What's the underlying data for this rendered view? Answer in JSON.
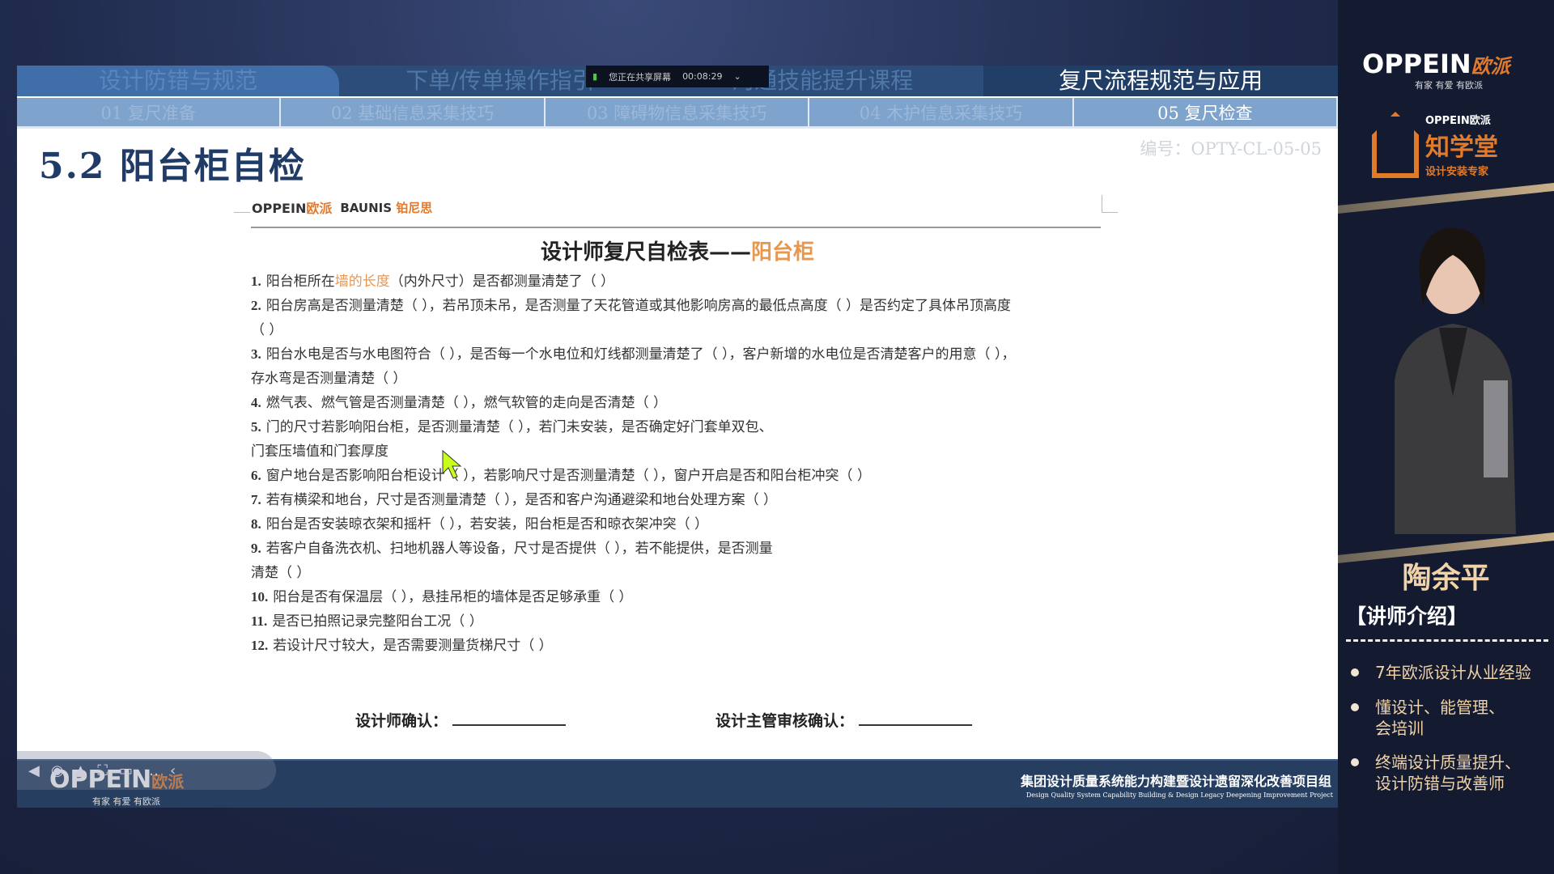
{
  "header": {
    "modules": [
      "设计防错与规范",
      "下单/传单操作指引",
      "沟通技能提升课程",
      "复尺流程规范与应用"
    ],
    "active_module": 3,
    "tabs": [
      "01  复尺准备",
      "02  基础信息采集技巧",
      "03  障碍物信息采集技巧",
      "04  木护信息采集技巧",
      "05  复尺检查"
    ],
    "active_tab": 4
  },
  "share_bar": {
    "text": "您正在共享屏幕",
    "time": "00:08:29"
  },
  "slide": {
    "title": "5.2  阳台柜自检",
    "code": "编号：OPTY-CL-05-05"
  },
  "doc": {
    "logo_oppein": "OPPEIN",
    "logo_oppein_cn": "欧派",
    "logo_baunis": "BAUNIS",
    "logo_baunis_cn": "铂尼思",
    "title": "设计师复尺自检表——",
    "title_highlight": "阳台柜",
    "lines": [
      {
        "num": "1.",
        "segs": [
          {
            "t": "阳台柜所在"
          },
          {
            "t": "墙的长度",
            "hl": true
          },
          {
            "t": "（内外尺寸）是否都测量清楚了（    ）"
          }
        ]
      },
      {
        "num": "2.",
        "segs": [
          {
            "t": "阳台房高是否测量清楚（    ），若吊顶未吊，是否测量了天花管道或其他影响房高的最低点高度（    ）是否约定了具体吊顶高度"
          }
        ]
      },
      {
        "num": "",
        "segs": [
          {
            "t": "（    ）"
          }
        ]
      },
      {
        "num": "3.",
        "segs": [
          {
            "t": "阳台水电是否与水电图符合（    ），是否每一个水电位和灯线都测量清楚了（    ），客户新增的水电位是否清楚客户的用意（    ），"
          }
        ]
      },
      {
        "num": "",
        "segs": [
          {
            "t": "存水弯是否测量清楚（    ）"
          }
        ]
      },
      {
        "num": "4.",
        "segs": [
          {
            "t": "燃气表、燃气管是否测量清楚（    ），燃气软管的走向是否清楚（    ）"
          }
        ]
      },
      {
        "num": "5.",
        "segs": [
          {
            "t": "门的尺寸若影响阳台柜，是否测量清楚（    ），若门未安装，是否确定好门套单双包、"
          }
        ]
      },
      {
        "num": "",
        "segs": [
          {
            "t": "门套压墙值和门套厚度"
          }
        ]
      },
      {
        "num": "6.",
        "segs": [
          {
            "t": "窗户地台是否影响阳台柜设计（    ），若影响尺寸是否测量清楚（    ），窗户开启是否和阳台柜冲突（    ）"
          }
        ]
      },
      {
        "num": "7.",
        "segs": [
          {
            "t": "若有横梁和地台，尺寸是否测量清楚（    ），是否和客户沟通避梁和地台处理方案（    ）"
          }
        ]
      },
      {
        "num": "8.",
        "segs": [
          {
            "t": "阳台是否安装晾衣架和摇杆（    ），若安装，阳台柜是否和晾衣架冲突（    ）"
          }
        ]
      },
      {
        "num": "9.",
        "segs": [
          {
            "t": "若客户自备洗衣机、扫地机器人等设备，尺寸是否提供（    ），若不能提供，是否测量"
          }
        ]
      },
      {
        "num": "",
        "segs": [
          {
            "t": "清楚（    ）"
          }
        ]
      },
      {
        "num": "10.",
        "segs": [
          {
            "t": "阳台是否有保温层（  ），悬挂吊柜的墙体是否足够承重（    ）"
          }
        ]
      },
      {
        "num": "11.",
        "segs": [
          {
            "t": "是否已拍照记录完整阳台工况（    ）"
          }
        ]
      },
      {
        "num": "12.",
        "segs": [
          {
            "t": "若设计尺寸较大，是否需要测量货梯尺寸（    ）"
          }
        ]
      }
    ],
    "sign_designer": "设计师确认：",
    "sign_manager": "设计主管审核确认："
  },
  "footer": {
    "logo": "OPPEIN",
    "logo_cn": "欧派",
    "slogan": "有家 有爱 有欧派",
    "cn": "集团设计质量系统能力构建暨设计遗留深化改善项目组",
    "en": "Design Quality System Capability Building & Design Legacy Deepening Improvement Project"
  },
  "controls": [
    "◀",
    "◉",
    "▲",
    "⛶",
    "▭",
    "…",
    "‹"
  ],
  "panel": {
    "logo": "OPPEIN",
    "logo_cn": "欧派",
    "slogan": "有家 有爱 有欧派",
    "zxt_brand": "OPPEIN欧派",
    "zxt_name": "知学堂",
    "zxt_sub": "设计安装专家",
    "name": "陶余平",
    "intro": "【讲师介绍】",
    "bullets": [
      "7年欧派设计从业经验",
      "懂设计、能管理、会培训",
      "终端设计质量提升、设计防错与改善师"
    ]
  },
  "colors": {
    "header_dark": "#213e66",
    "tab_blue": "#7ea3cd",
    "highlight": "#e8974e",
    "brand_orange": "#e07a2e",
    "panel_bg": "#141a30"
  }
}
